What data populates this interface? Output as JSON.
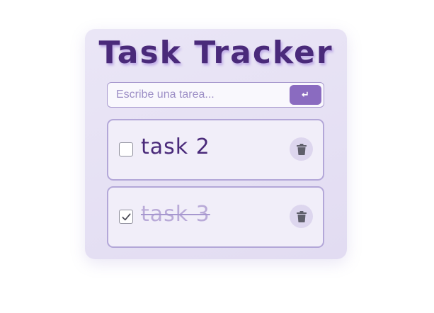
{
  "app": {
    "title": "Task Tracker"
  },
  "input": {
    "placeholder": "Escribe una tarea...",
    "value": "",
    "submit_label": "↵"
  },
  "tasks": [
    {
      "text": "task 2",
      "completed": false
    },
    {
      "text": "task 3",
      "completed": true
    }
  ],
  "colors": {
    "accent": "#8a6bc0",
    "title": "#4a2a7a",
    "card_background": "#e6e1f4",
    "task_background": "#f1eef9",
    "done_text": "#b9aad8"
  },
  "icons": {
    "delete": "trash-icon",
    "checkbox_checked": "checkmark-icon"
  }
}
